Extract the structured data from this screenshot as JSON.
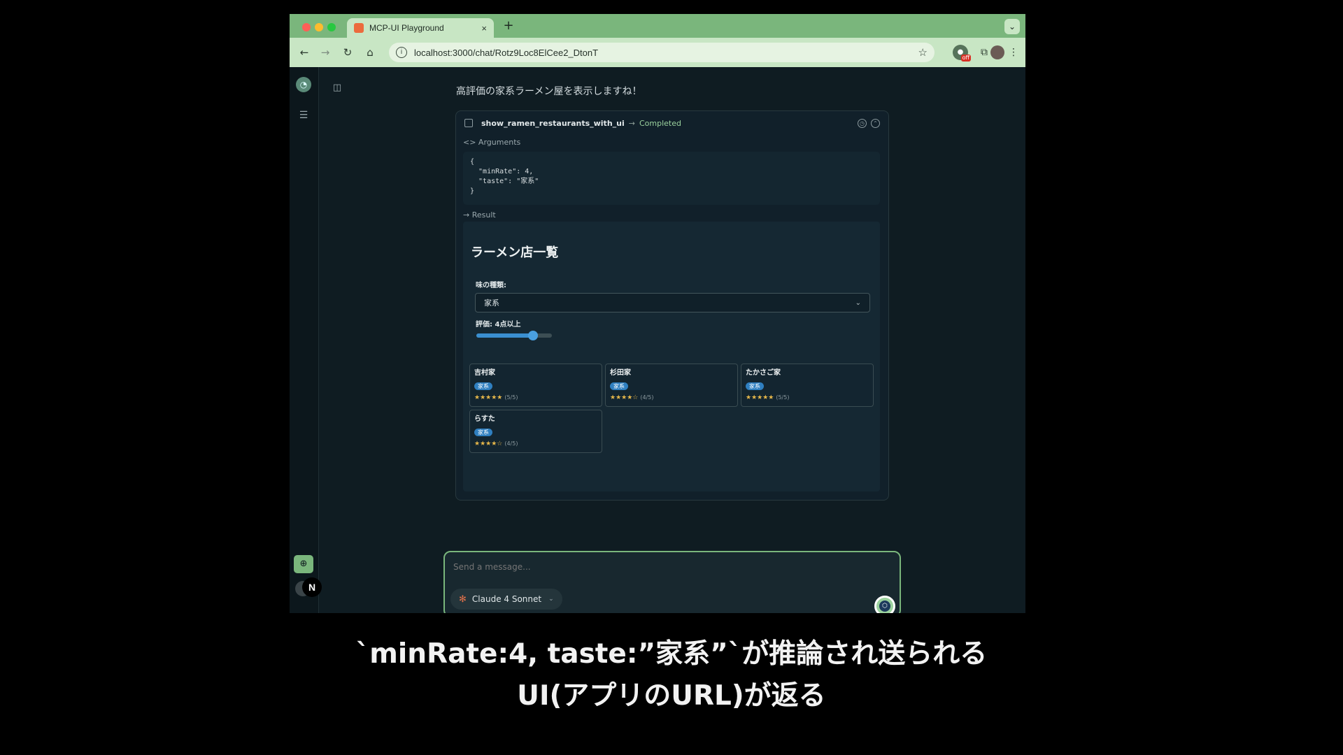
{
  "browser": {
    "tab_title": "MCP-UI Playground",
    "tab_close": "×",
    "new_tab": "+",
    "tabs_menu": "⌄",
    "url": "localhost:3000/chat/Rotz9Loc8ElCee2_DtonT",
    "nav": {
      "back": "←",
      "forward": "→",
      "reload": "↻",
      "home": "⌂",
      "star": "☆",
      "puzzle": "⧉",
      "menu": "⋮",
      "rec_badge": "off"
    }
  },
  "chat": {
    "assistant_message": "高評価の家系ラーメン屋を表示しますね！",
    "tool_call": {
      "name": "show_ramen_restaurants_with_ui",
      "arrow": "→",
      "status": "Completed",
      "arguments_label": "<> Arguments",
      "arguments_json": "{\n  \"minRate\": 4,\n  \"taste\": \"家系\"\n}",
      "result_label": "→ Result"
    },
    "result_ui": {
      "title": "ラーメン店一覧",
      "taste_label": "味の種類:",
      "taste_value": "家系",
      "rating_label": "評価: 4点以上",
      "slider_fraction": 0.75,
      "restaurants": [
        {
          "name": "吉村家",
          "tag": "家系",
          "stars": "★★★★★",
          "score": "(5/5)"
        },
        {
          "name": "杉田家",
          "tag": "家系",
          "stars": "★★★★☆",
          "score": "(4/5)"
        },
        {
          "name": "たかさご家",
          "tag": "家系",
          "stars": "★★★★★",
          "score": "(5/5)"
        },
        {
          "name": "らすた",
          "tag": "家系",
          "stars": "★★★★☆",
          "score": "(4/5)"
        }
      ]
    },
    "composer": {
      "placeholder": "Send a message...",
      "model": "Claude 4 Sonnet"
    }
  },
  "sidebar": {
    "next_badge": "N"
  },
  "subtitles": {
    "line1": "`minRate:4, taste:”家系”`が推論され送られる",
    "line2": "UI(アプリのURL)が返る"
  },
  "colors": {
    "accent": "#7ab67c",
    "background": "#0f1c22",
    "star": "#e8b84a",
    "tag": "#2f7fc0"
  }
}
